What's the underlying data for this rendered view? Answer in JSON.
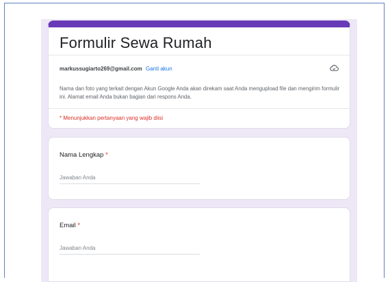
{
  "form": {
    "title": "Formulir Sewa Rumah",
    "account_email": "markussugiarto269@gmail.com",
    "switch_account": "Ganti akun",
    "notice": "Nama dan foto yang terkait dengan Akun Google Anda akan direkam saat Anda mengupload file dan mengirim formulir ini. Alamat email Anda bukan bagian dari respons Anda.",
    "required_note": "* Menunjukkan pertanyaan yang wajib diisi",
    "accent_color": "#673ab7",
    "required_color": "#d93025"
  },
  "questions": [
    {
      "label": "Nama Lengkap",
      "required_mark": "*",
      "placeholder": "Jawaban Anda"
    },
    {
      "label": "Email",
      "required_mark": "*",
      "placeholder": "Jawaban Anda"
    }
  ],
  "icons": {
    "cloud": "cloud-icon"
  }
}
